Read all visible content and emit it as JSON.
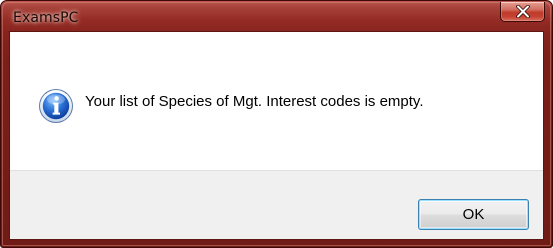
{
  "window": {
    "title": "ExamsPC",
    "close_icon": "close-x-icon",
    "accent_color": "#8b241d"
  },
  "dialog": {
    "icon": "information-icon",
    "message": "Your list of Species of Mgt. Interest codes is empty.",
    "ok_label": "OK"
  }
}
